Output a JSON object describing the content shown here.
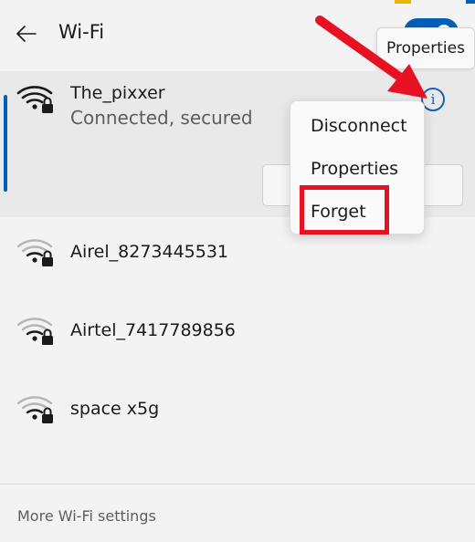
{
  "header": {
    "title": "Wi-Fi",
    "back_icon": "arrow-left-icon",
    "tooltip": "Properties"
  },
  "networks": [
    {
      "name": "The_pixxer",
      "status": "Connected, secured",
      "signal": "full",
      "secured": true
    },
    {
      "name": "Airel_8273445531",
      "signal": "medium",
      "secured": true
    },
    {
      "name": "Airtel_7417789856",
      "signal": "medium",
      "secured": true
    },
    {
      "name": "space x5g",
      "signal": "medium",
      "secured": true
    }
  ],
  "info_button": {
    "glyph": "i"
  },
  "context_menu": {
    "items": [
      "Disconnect",
      "Properties",
      "Forget"
    ],
    "highlighted": "Forget"
  },
  "footer": {
    "link": "More Wi-Fi settings"
  },
  "colors": {
    "accent": "#005fb8",
    "annotation_red": "#e81123"
  }
}
